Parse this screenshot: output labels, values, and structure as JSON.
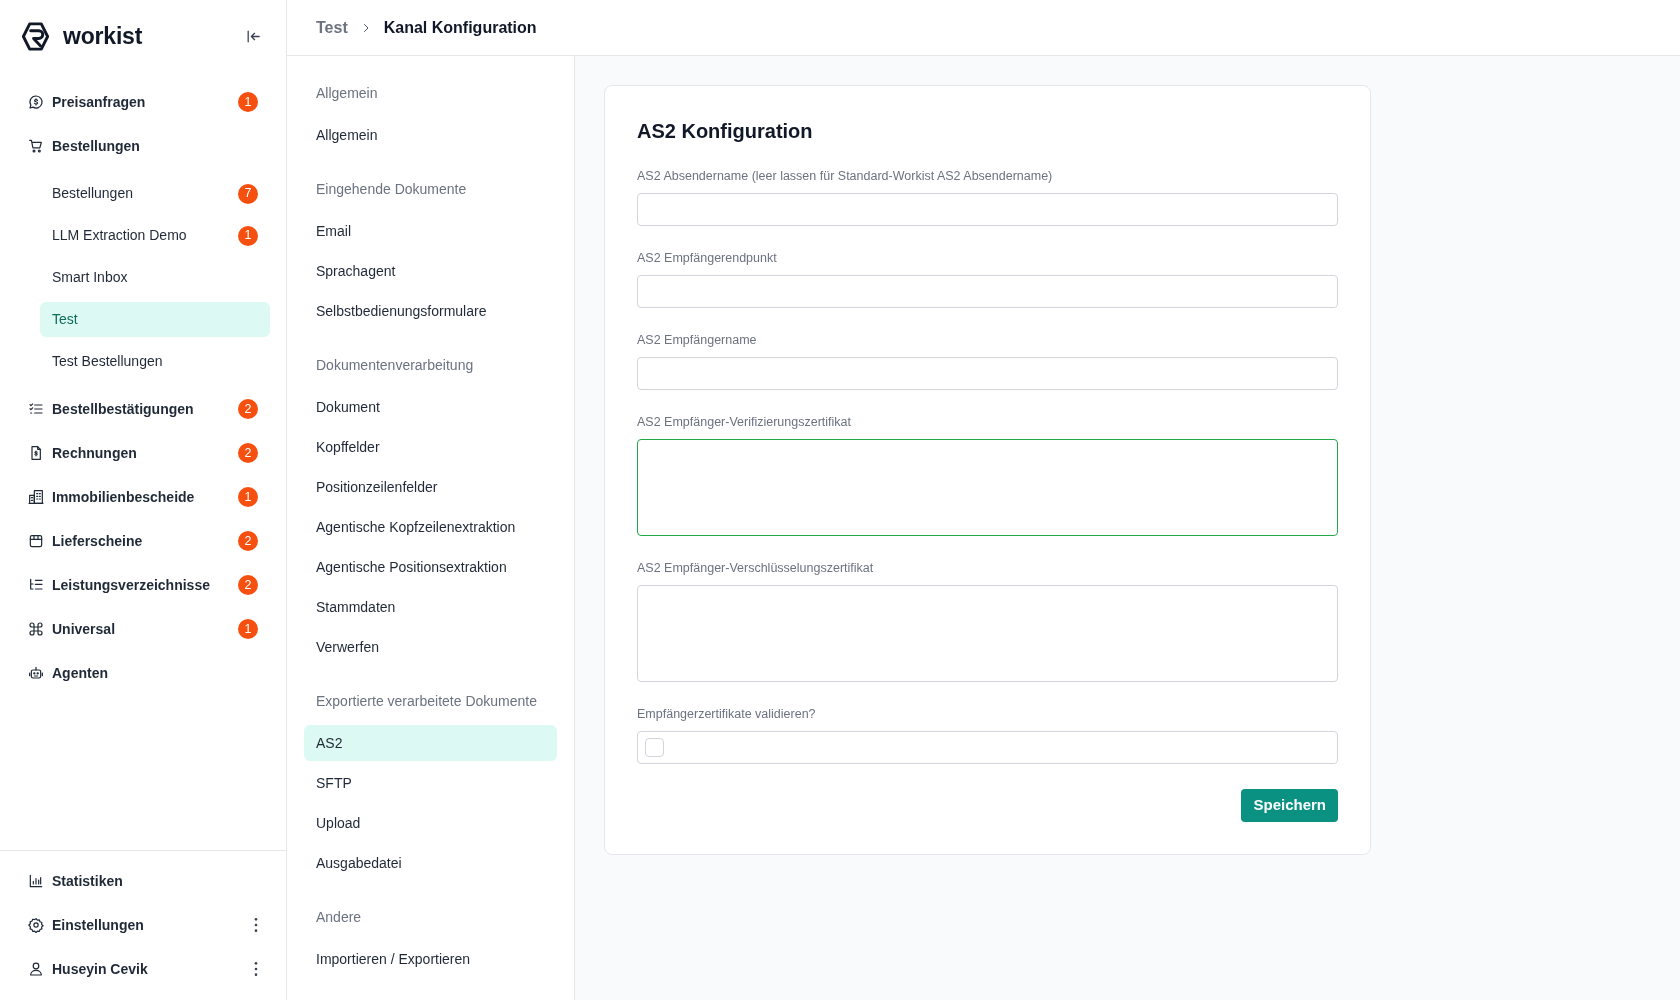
{
  "sidebar": {
    "brand": "workist",
    "nav": [
      {
        "label": "Preisanfragen",
        "badge": "1",
        "selected": false
      },
      {
        "label": "Bestellungen",
        "selected": false,
        "expanded": true,
        "children": [
          {
            "label": "Bestellungen",
            "badge": "7",
            "selected": false
          },
          {
            "label": "LLM Extraction Demo",
            "badge": "1",
            "selected": false
          },
          {
            "label": "Smart Inbox",
            "selected": false
          },
          {
            "label": "Test",
            "selected": true
          },
          {
            "label": "Test Bestellungen",
            "selected": false
          }
        ]
      },
      {
        "label": "Bestellbestätigungen",
        "badge": "2",
        "selected": false
      },
      {
        "label": "Rechnungen",
        "badge": "2",
        "selected": false
      },
      {
        "label": "Immobilienbescheide",
        "badge": "1",
        "selected": false
      },
      {
        "label": "Lieferscheine",
        "badge": "2",
        "selected": false
      },
      {
        "label": "Leistungsverzeichnisse",
        "badge": "2",
        "selected": false
      },
      {
        "label": "Universal",
        "badge": "1",
        "selected": false
      },
      {
        "label": "Agenten",
        "selected": false
      }
    ],
    "footer": [
      {
        "label": "Statistiken",
        "selected": false,
        "menu": false
      },
      {
        "label": "Einstellungen",
        "selected": false,
        "menu": true
      },
      {
        "label": "Huseyin Cevik",
        "selected": false,
        "menu": true
      }
    ]
  },
  "breadcrumb": [
    {
      "label": "Test",
      "current": false
    },
    {
      "label": "Kanal Konfiguration",
      "current": true
    }
  ],
  "settings_nav": [
    {
      "heading": "Allgemein",
      "items": [
        {
          "label": "Allgemein",
          "selected": false
        }
      ]
    },
    {
      "heading": "Eingehende Dokumente",
      "items": [
        {
          "label": "Email",
          "selected": false
        },
        {
          "label": "Sprachagent",
          "selected": false
        },
        {
          "label": "Selbstbedienungsformulare",
          "selected": false
        }
      ]
    },
    {
      "heading": "Dokumentenverarbeitung",
      "items": [
        {
          "label": "Dokument",
          "selected": false
        },
        {
          "label": "Kopffelder",
          "selected": false
        },
        {
          "label": "Positionzeilenfelder",
          "selected": false
        },
        {
          "label": "Agentische Kopfzeilenextraktion",
          "selected": false
        },
        {
          "label": "Agentische Positionsextraktion",
          "selected": false
        },
        {
          "label": "Stammdaten",
          "selected": false
        },
        {
          "label": "Verwerfen",
          "selected": false
        }
      ]
    },
    {
      "heading": "Exportierte verarbeitete Dokumente",
      "items": [
        {
          "label": "AS2",
          "selected": true
        },
        {
          "label": "SFTP",
          "selected": false
        },
        {
          "label": "Upload",
          "selected": false
        },
        {
          "label": "Ausgabedatei",
          "selected": false
        }
      ]
    },
    {
      "heading": "Andere",
      "items": [
        {
          "label": "Importieren / Exportieren",
          "selected": false
        }
      ]
    }
  ],
  "form": {
    "title": "AS2 Konfiguration",
    "fields": [
      {
        "kind": "input",
        "label": "AS2 Absendername (leer lassen für Standard-Workist AS2 Absendername)",
        "focused": false
      },
      {
        "kind": "input",
        "label": "AS2 Empfängerendpunkt",
        "focused": false
      },
      {
        "kind": "input",
        "label": "AS2 Empfängername",
        "focused": false
      },
      {
        "kind": "textarea",
        "label": "AS2 Empfänger-Verifizierungszertifikat",
        "focused": true
      },
      {
        "kind": "textarea",
        "label": "AS2 Empfänger-Verschlüsselungszertifikat",
        "focused": false
      },
      {
        "kind": "checkbox",
        "label": "Empfängerzertifikate validieren?",
        "focused": false,
        "checked": false
      }
    ],
    "submit": "Speichern"
  }
}
